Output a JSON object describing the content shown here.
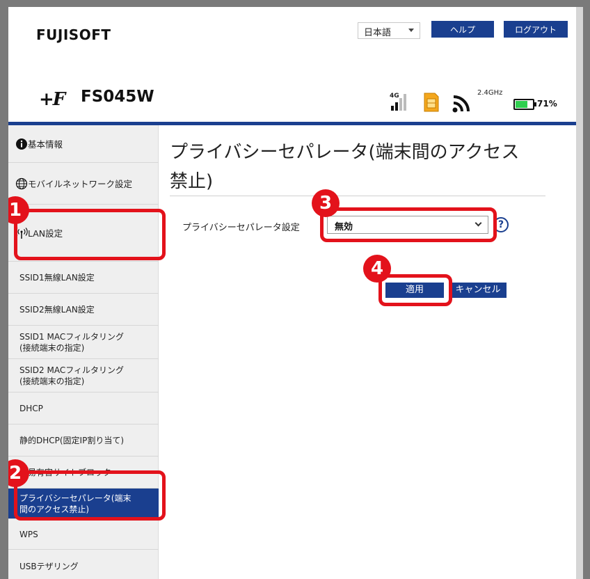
{
  "header": {
    "brand": "FUJISOFT",
    "logo_mark": "+F",
    "model": "FS045W",
    "language": "日本語",
    "help_label": "ヘルプ",
    "logout_label": "ログアウト"
  },
  "status": {
    "network": "4G",
    "wifi_band": "2.4GHz",
    "battery": "71%",
    "battery_level": 0.71,
    "icons": [
      "signal-bars-icon",
      "sim-card-icon",
      "wifi-icon",
      "battery-icon"
    ]
  },
  "sidebar": {
    "items": [
      {
        "label": "基本情報",
        "icon": "info-icon"
      },
      {
        "label": "モバイルネットワーク設定",
        "icon": "globe-icon"
      },
      {
        "label": "LAN設定",
        "icon": "antenna-icon"
      },
      {
        "label": "SSID1無線LAN設定"
      },
      {
        "label": "SSID2無線LAN設定"
      },
      {
        "label": "SSID1 MACフィルタリング\n(接続端末の指定)"
      },
      {
        "label": "SSID2 MACフィルタリング\n(接続端末の指定)"
      },
      {
        "label": "DHCP"
      },
      {
        "label": "静的DHCP(固定IP割り当て)"
      },
      {
        "label": "簡易有害サイトブロック"
      },
      {
        "label": "プライバシーセパレータ(端末\n間のアクセス禁止)"
      },
      {
        "label": "WPS"
      },
      {
        "label": "USBテザリング"
      }
    ]
  },
  "main": {
    "title": "プライバシーセパレータ(端末間のアクセス禁止)",
    "field_label": "プライバシーセパレータ設定",
    "field_value": "無効",
    "help_symbol": "?",
    "apply_label": "適用",
    "cancel_label": "キャンセル"
  },
  "annotations": [
    "1",
    "2",
    "3",
    "4"
  ],
  "colors": {
    "accent": "#1a3f8f",
    "callout": "#e3121b",
    "battery": "#2fcf4f"
  }
}
